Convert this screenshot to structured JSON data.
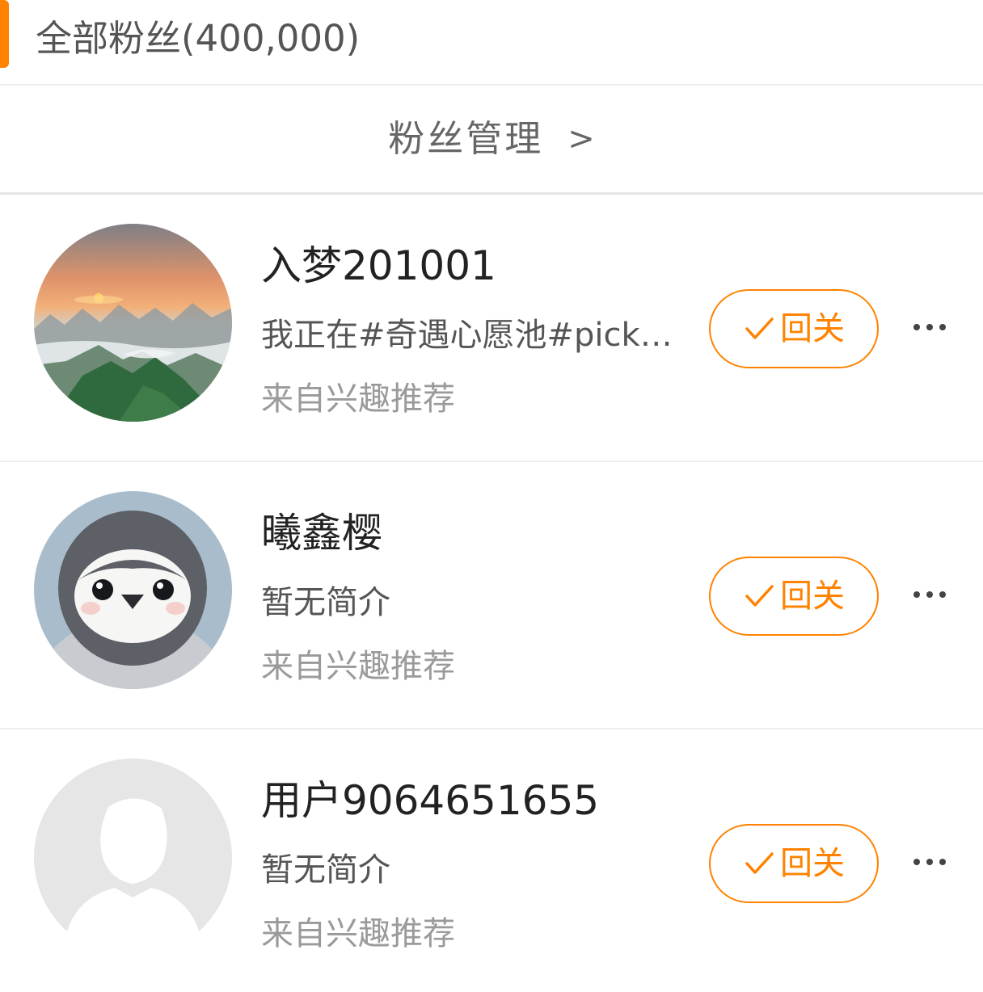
{
  "header": {
    "title": "全部粉丝(400,000)"
  },
  "management": {
    "label": "粉丝管理",
    "chevron": ">"
  },
  "fans": [
    {
      "name": "入梦201001",
      "bio": "我正在#奇遇心愿池#pick…",
      "source": "来自兴趣推荐",
      "avatar": "sunset-mountain-avatar",
      "follow_back_label": "回关"
    },
    {
      "name": "曦鑫樱",
      "bio": "暂无简介",
      "source": "来自兴趣推荐",
      "avatar": "penguin-avatar",
      "follow_back_label": "回关"
    },
    {
      "name": "用户9064651655",
      "bio": "暂无简介",
      "source": "来自兴趣推荐",
      "avatar": "default-user-avatar",
      "follow_back_label": "回关"
    }
  ],
  "icons": {
    "check": "check-icon",
    "more": "more-dots-icon"
  },
  "colors": {
    "accent": "#ff8200",
    "name_text": "#222222",
    "secondary_text": "#555555",
    "tertiary_text": "#9a9a9a",
    "divider": "#eeeeee"
  }
}
